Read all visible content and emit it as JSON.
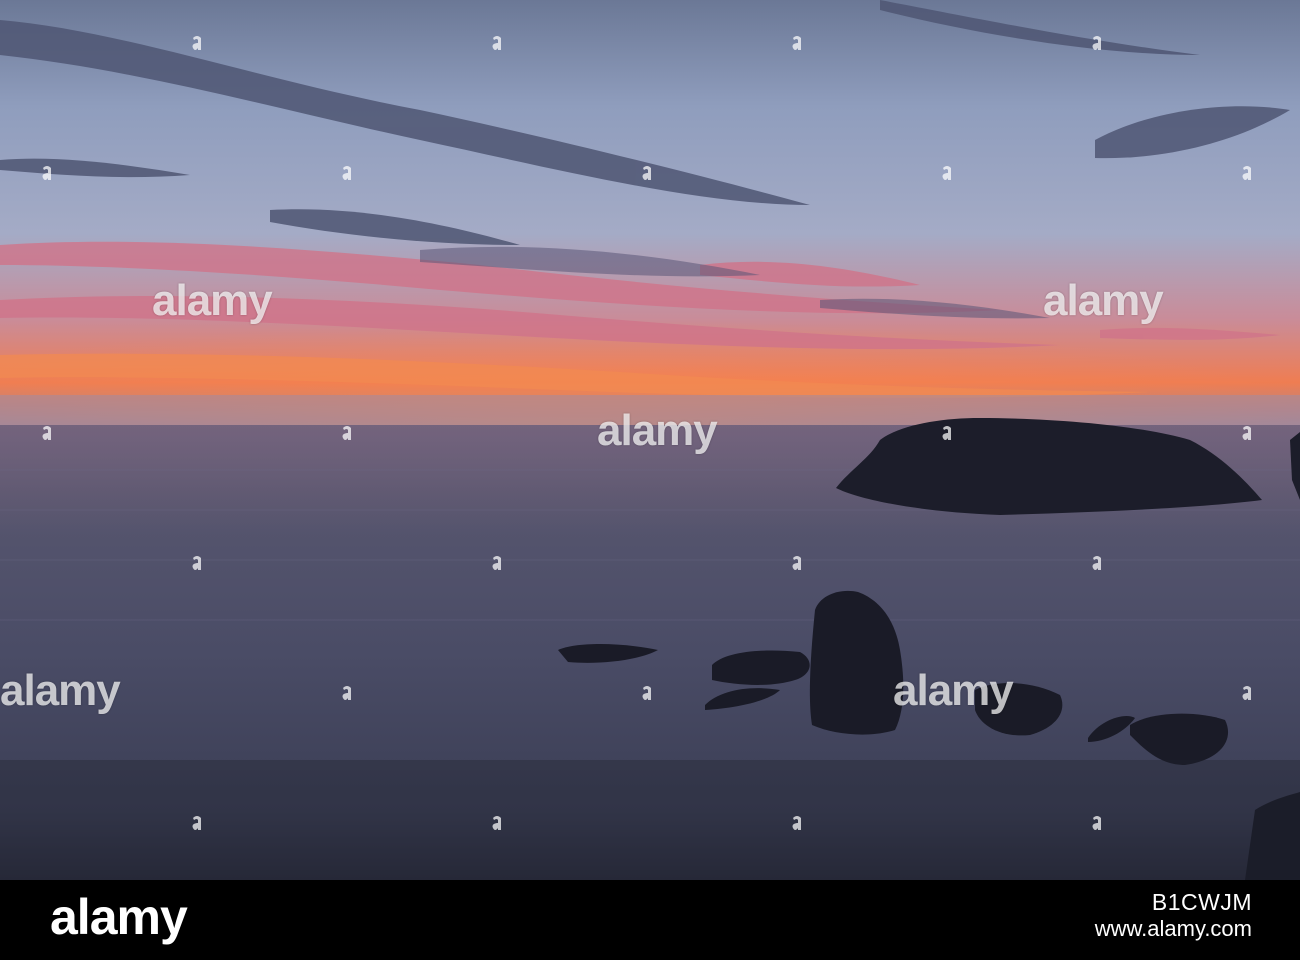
{
  "watermark": {
    "text": "alamy"
  },
  "footer": {
    "logo": "alamy",
    "image_id": "B1CWJM",
    "url": "www.alamy.com"
  },
  "colors": {
    "sky_top": "#6f7d9a",
    "sky_mid": "#98a6c6",
    "horizon_glow": "#f07a4e",
    "cloud_pink": "#d98089",
    "sea": "#4c4d68",
    "rock_silhouette": "#1a1a25",
    "footer_bg": "#000000"
  }
}
